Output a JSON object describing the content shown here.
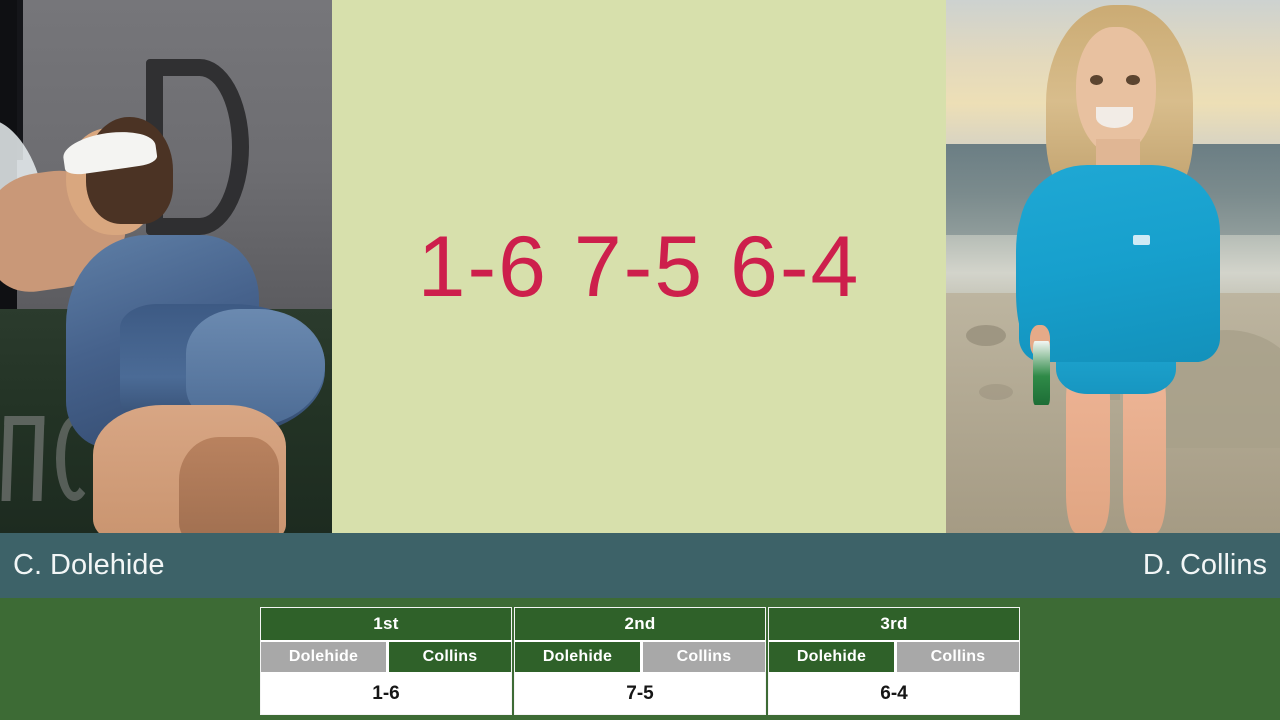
{
  "headline": {
    "score": "1-6 7-5 6-4",
    "score_color": "#cd1f4c",
    "panel_color": "#d7e0ac"
  },
  "players": {
    "left": {
      "display_name": "C. Dolehide",
      "short_name": "Dolehide",
      "photo_alt": "tennis-player-blue-dress-on-court"
    },
    "right": {
      "display_name": "D. Collins",
      "short_name": "Collins",
      "photo_alt": "blonde-woman-blue-sweatshirt-on-beach"
    }
  },
  "name_bar": {
    "background_color": "#3d6268"
  },
  "table_area": {
    "background_color": "#3d6b35"
  },
  "score_table": {
    "winner_color": "#2f6129",
    "loser_color": "#a8a8a8",
    "sets": [
      {
        "label": "1st",
        "left_player": "Dolehide",
        "right_player": "Collins",
        "left_won": false,
        "right_won": true,
        "score": "1-6"
      },
      {
        "label": "2nd",
        "left_player": "Dolehide",
        "right_player": "Collins",
        "left_won": true,
        "right_won": false,
        "score": "7-5"
      },
      {
        "label": "3rd",
        "left_player": "Dolehide",
        "right_player": "Collins",
        "left_won": true,
        "right_won": false,
        "score": "6-4"
      }
    ]
  }
}
